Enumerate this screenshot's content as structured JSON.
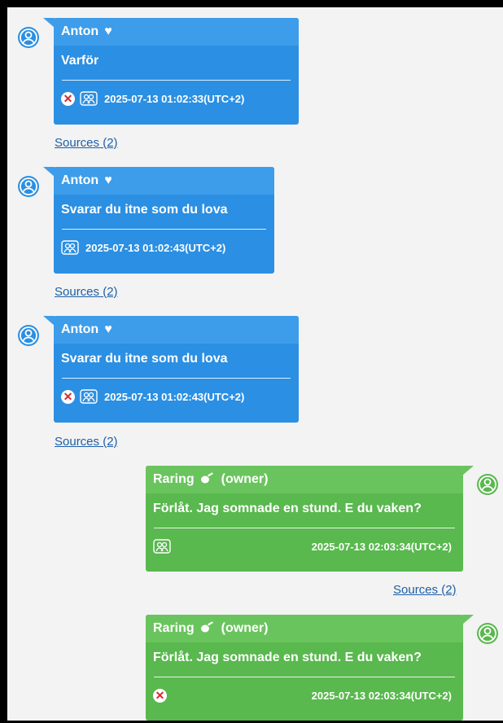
{
  "colors": {
    "incoming": "#2b8fe3",
    "outgoing": "#59b84e",
    "link": "#1c5fa8",
    "delete": "#d9262c"
  },
  "messages": [
    {
      "sender": "Anton",
      "heart": "♥",
      "text": "Varför",
      "timestamp": "2025-07-13 01:02:33(UTC+2)",
      "sources": "Sources (2)",
      "has_delete": true,
      "icons": [
        "user-avatar-icon",
        "heart-icon",
        "delete-icon",
        "group-icon"
      ]
    },
    {
      "sender": "Anton",
      "heart": "♥",
      "text": "Svarar du itne som du lova",
      "timestamp": "2025-07-13 01:02:43(UTC+2)",
      "sources": "Sources (2)",
      "has_delete": false
    },
    {
      "sender": "Anton",
      "heart": "♥",
      "text": "Svarar du itne som du lova",
      "timestamp": "2025-07-13 01:02:43(UTC+2)",
      "sources": "Sources (2)",
      "has_delete": true
    },
    {
      "sender": "Raring",
      "owner": "(owner)",
      "text": "Förlåt. Jag somnade en stund. E du vaken?",
      "timestamp": "2025-07-13 02:03:34(UTC+2)",
      "sources": "Sources (2)",
      "has_delete": false
    },
    {
      "sender": "Raring",
      "owner": "(owner)",
      "text": "Förlåt. Jag somnade en stund. E du vaken?",
      "timestamp": "2025-07-13 02:03:34(UTC+2)",
      "has_delete": true
    }
  ]
}
